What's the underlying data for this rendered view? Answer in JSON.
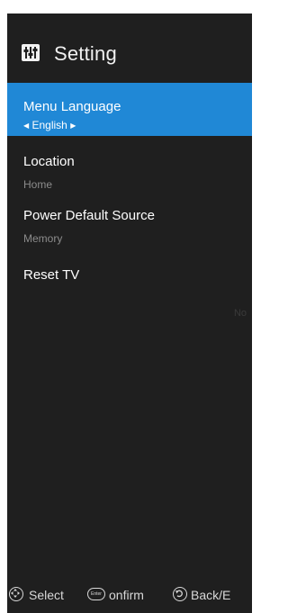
{
  "header": {
    "title": "Setting",
    "icon": "settings-sliders-icon"
  },
  "menu": {
    "items": [
      {
        "label": "Menu Language",
        "value": "English",
        "selected": true
      },
      {
        "label": "Location",
        "value": "Home"
      },
      {
        "label": "Power Default Source",
        "value": "Memory"
      },
      {
        "label": "Reset TV"
      }
    ]
  },
  "footer": {
    "select_label": "Select",
    "confirm_label": "onfirm",
    "enter_icon_text": "Enter",
    "back_label": "Back/E"
  },
  "background_hint": "No",
  "colors": {
    "panel": "#1f1f1f",
    "accent": "#2088d6",
    "muted_text": "#8c8c8c"
  }
}
